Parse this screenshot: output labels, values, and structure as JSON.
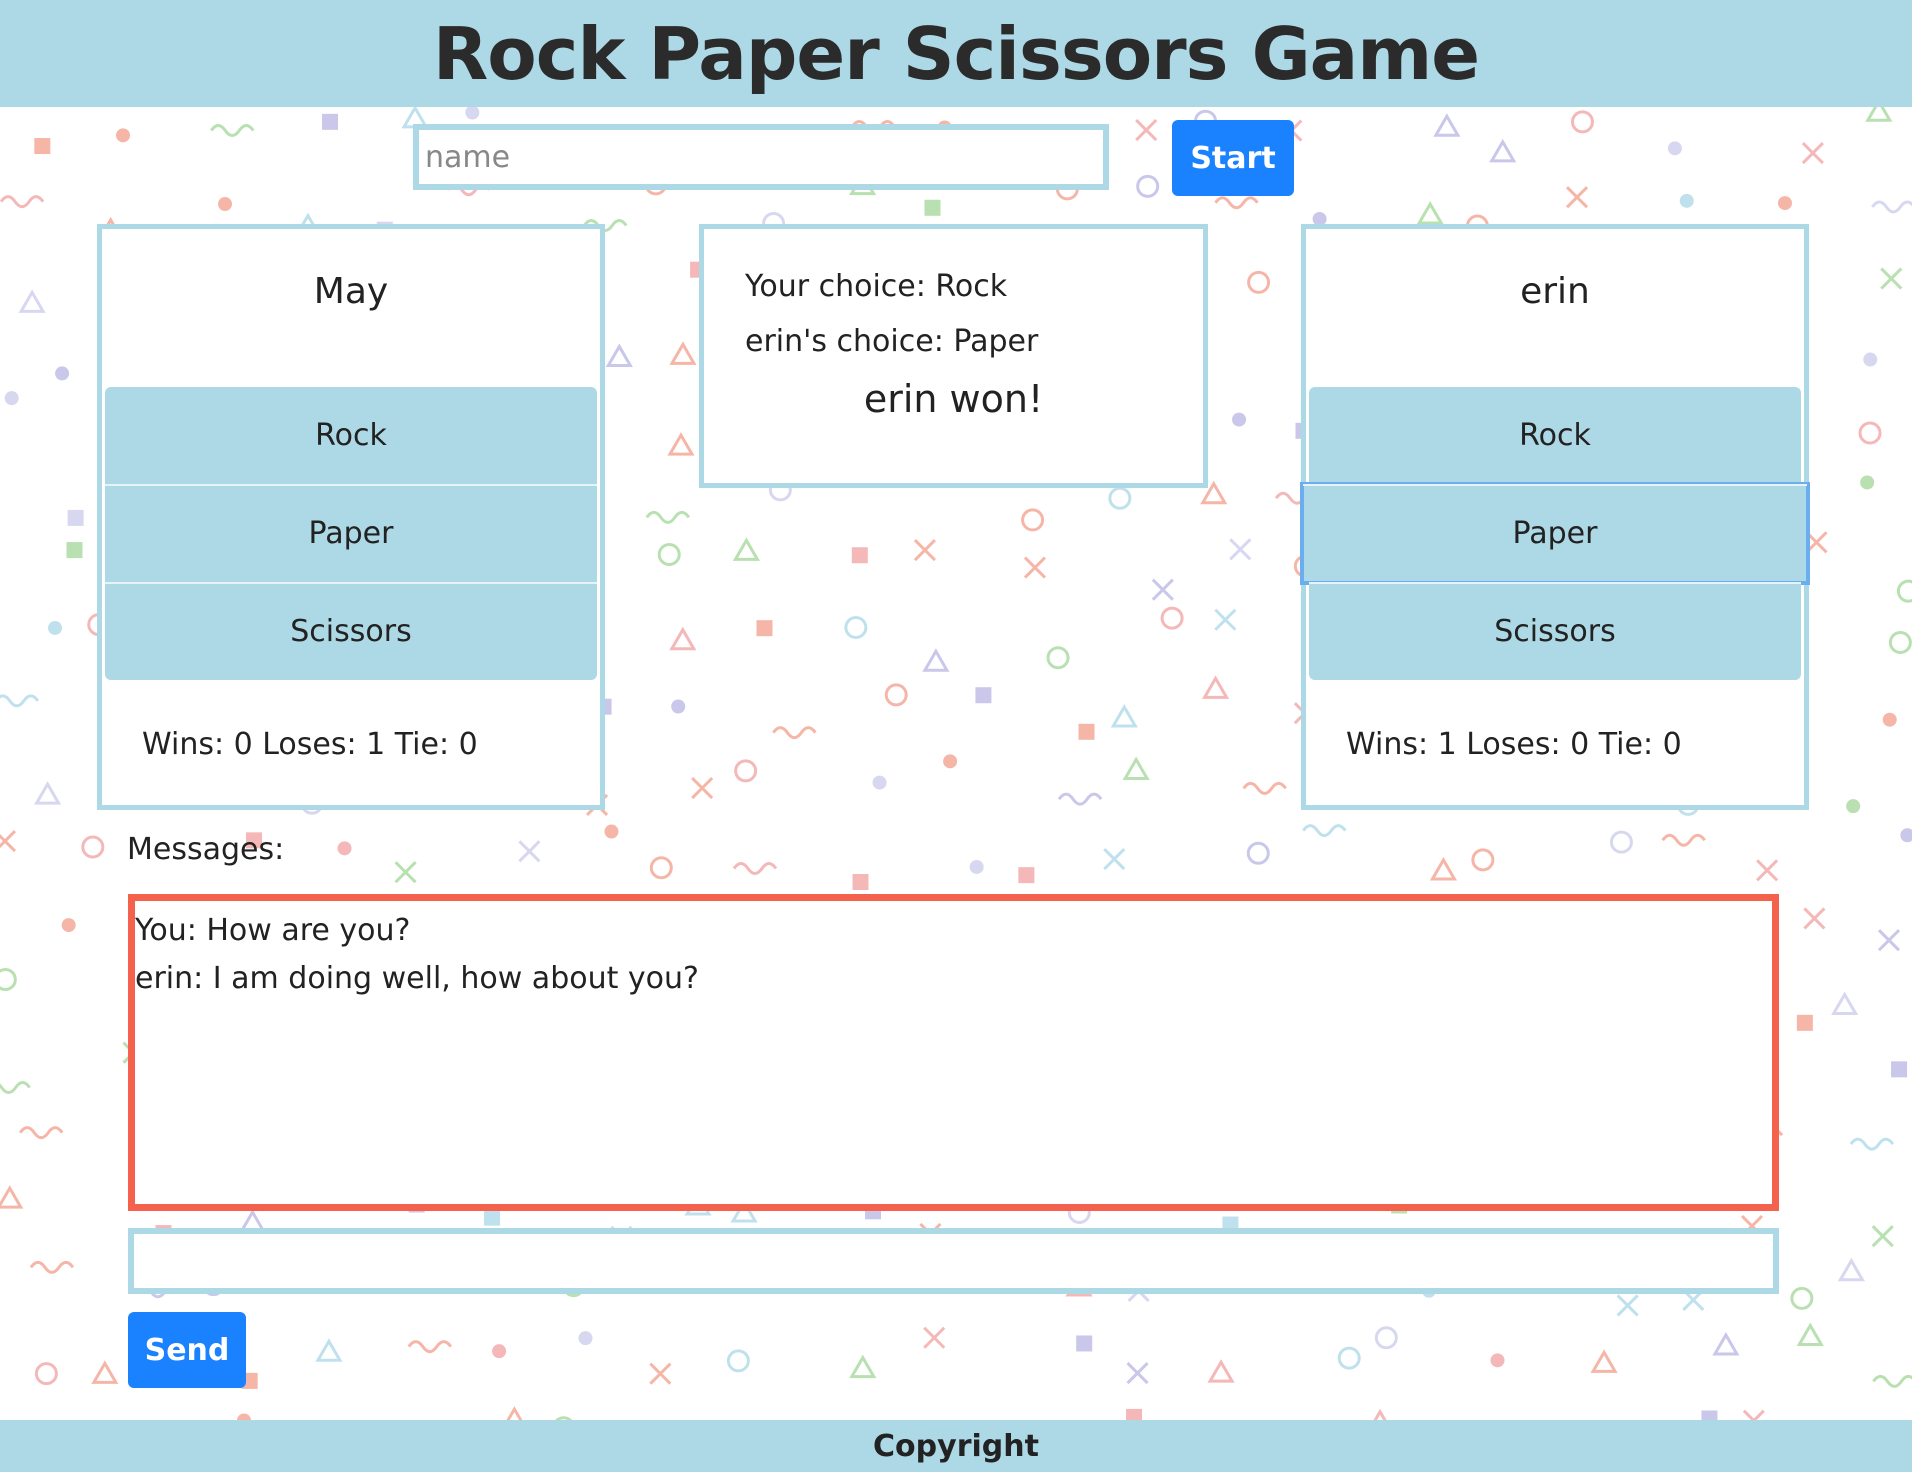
{
  "header": {
    "title": "Rock Paper Scissors Game"
  },
  "start": {
    "name_placeholder": "name",
    "name_value": "",
    "start_label": "Start"
  },
  "players": [
    {
      "name": "May",
      "choices": [
        "Rock",
        "Paper",
        "Scissors"
      ],
      "selected": "",
      "score_text": "Wins: 0 Loses: 1 Tie: 0"
    },
    {
      "name": "erin",
      "choices": [
        "Rock",
        "Paper",
        "Scissors"
      ],
      "selected": "Paper",
      "score_text": "Wins: 1 Loses: 0 Tie: 0"
    }
  ],
  "result": {
    "your_choice": "Your choice: Rock",
    "opponent_choice": "erin's choice: Paper",
    "winner": "erin won!"
  },
  "messages": {
    "label": "Messages:",
    "lines": [
      "You: How are you?",
      "erin: I am doing well, how about you?"
    ],
    "input_value": "",
    "send_label": "Send"
  },
  "footer": {
    "text": "Copyright"
  },
  "colors": {
    "accent": "#add8e6",
    "button": "#1a82ff",
    "message_border": "#f4624e",
    "selected_outline": "#6aaeef"
  }
}
